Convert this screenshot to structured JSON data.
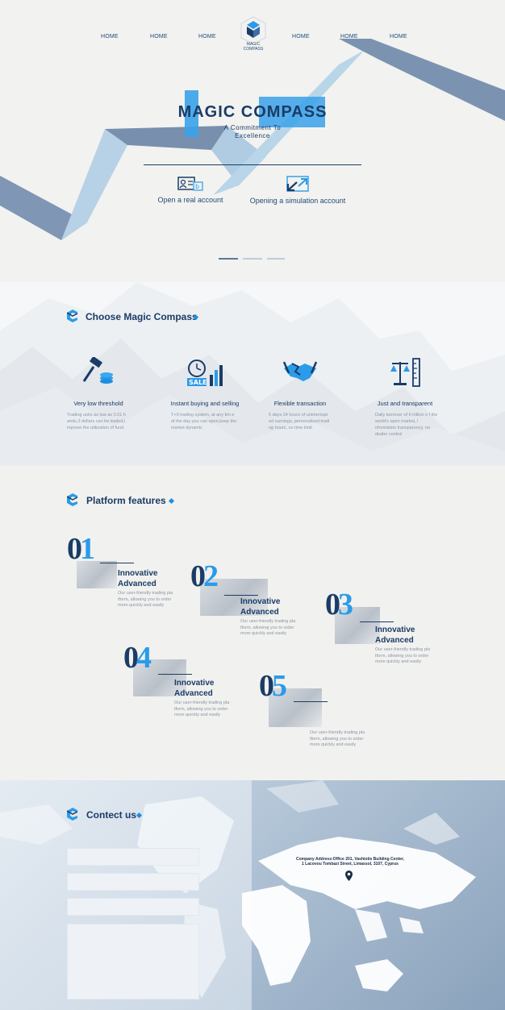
{
  "nav": {
    "items": [
      "HOME",
      "HOME",
      "HOME",
      "HOME",
      "HOME",
      "HOME"
    ],
    "logo_text": "MAGIC\nCOMPASS"
  },
  "hero": {
    "title": "MAGIC COMPASS",
    "subtitle_line1": "A Commitment To",
    "subtitle_line2": "Excellence",
    "actions": [
      {
        "label": "Open a real account",
        "icon": "id-card-icon"
      },
      {
        "label": "Opening a simulation account",
        "icon": "arrows-exchange-icon"
      }
    ],
    "slider_active_index": 0,
    "slider_count": 3
  },
  "choose": {
    "heading": "Choose Magic Compass",
    "features": [
      {
        "title": "Very low threshold",
        "icon": "gavel-coins-icon",
        "desc": "Trading units as low as 0.01 h ands,3 dollars can be traded,i mprove the utilization of fund"
      },
      {
        "title": "Instant buying and selling",
        "icon": "alarm-sale-chart-icon",
        "desc": "T+0 trading system, at any tim e of the day you can open,keep the market dynamic"
      },
      {
        "title": "Flexible transaction",
        "icon": "handshake-icon",
        "desc": "5 days 24 hours of uninterrupt ed earnings, personalized tradi ng hours, no time limit"
      },
      {
        "title": "Just and transparent",
        "icon": "scales-ruler-icon",
        "desc": "Daily turnover of 6 trillion o f the world's open market, i nformation transparency, no dealer control"
      }
    ]
  },
  "platform": {
    "heading": "Platform features",
    "items": [
      {
        "num_a": "0",
        "num_b": "1",
        "title1": "Innovative",
        "title2": "Advanced",
        "desc": "Our user-friendly trading pla tform, allowing you to order more quickly and easily"
      },
      {
        "num_a": "0",
        "num_b": "2",
        "title1": "Innovative",
        "title2": "Advanced",
        "desc": "Our user-friendly trading pla tform, allowing you to order more quickly and easily"
      },
      {
        "num_a": "0",
        "num_b": "3",
        "title1": "Innovative",
        "title2": "Advanced",
        "desc": "Our user-friendly trading pla tform, allowing you to order more quickly and easily"
      },
      {
        "num_a": "0",
        "num_b": "4",
        "title1": "Innovative",
        "title2": "Advanced",
        "desc": "Our user-friendly trading pla tform, allowing you to order more quickly and easily"
      },
      {
        "num_a": "0",
        "num_b": "5",
        "title1": "",
        "title2": "",
        "desc": "Our user-friendly trading pla tform, allowing you to order more quickly and easily"
      }
    ]
  },
  "contact": {
    "heading": "Contect us",
    "fields": [
      "",
      "",
      "",
      ""
    ],
    "address_line1": "Company Address:Office 201, Vashiotis Building Center,",
    "address_line2": "1 Lacovou Tombazi Street, Limassol, 3107, Cyprus"
  },
  "colors": {
    "navy": "#1a3c66",
    "accent_blue": "#2a9be8",
    "ribbon_dark": "#6f89a8",
    "ribbon_light": "#b3cfe2"
  }
}
